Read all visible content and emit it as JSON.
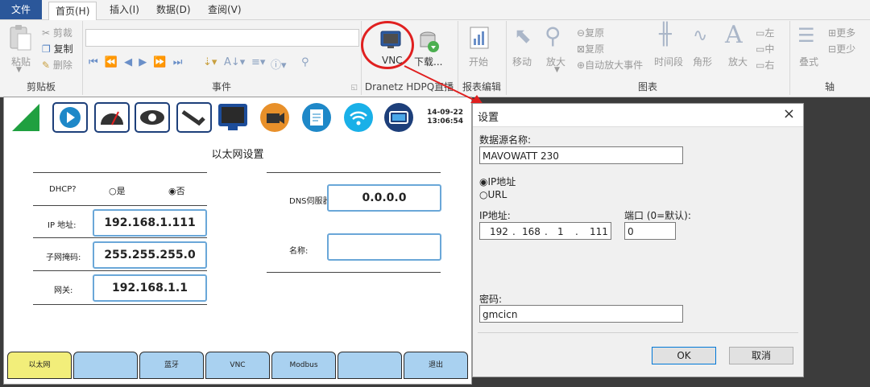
{
  "menubar": {
    "file": "文件",
    "tabs": [
      "首页(H)",
      "插入(I)",
      "数据(D)",
      "查阅(V)"
    ]
  },
  "clipboard": {
    "paste": "粘贴",
    "cut": "剪裁",
    "copy": "复制",
    "delete": "删除",
    "label": "剪贴板"
  },
  "events": {
    "label": "事件"
  },
  "dranetz": {
    "vnc": "VNC",
    "download": "下载...",
    "label": "Dranetz HDPQ直播"
  },
  "report": {
    "start": "开始",
    "label": "报表编辑"
  },
  "chart": {
    "move": "移动",
    "zoom": "放大",
    "restore1": "复原",
    "restore2": "复原",
    "auto_zoom": "自动放大事件",
    "time_period": "时间段",
    "angle": "角形",
    "zoom2": "放大",
    "left": "左",
    "middle": "中",
    "right": "右",
    "label": "图表"
  },
  "axis": {
    "stack": "叠式",
    "more": "更多",
    "less": "更少",
    "label": "轴"
  },
  "device": {
    "datetime_date": "14-09-22",
    "datetime_time": "13:06:54",
    "title": "以太网设置",
    "dhcp_label": "DHCP?",
    "dhcp_yes": "是",
    "dhcp_no": "否",
    "ip_label": "IP 地址:",
    "ip_value": "192.168.1.111",
    "subnet_label": "子网掩码:",
    "subnet_value": "255.255.255.0",
    "gateway_label": "网关:",
    "gateway_value": "192.168.1.1",
    "dns_label": "DNS伺服器:",
    "dns_value": "0.0.0.0",
    "name_label": "名称:",
    "name_value": "",
    "tabs": [
      "以太网",
      "",
      "蓝牙",
      "VNC",
      "Modbus",
      "",
      "退出"
    ]
  },
  "dialog": {
    "title": "设置",
    "close": "×",
    "source_label": "数据源名称:",
    "source_value": "MAVOWATT 230",
    "opt_ip": "IP地址",
    "opt_url": "URL",
    "ip_label": "IP地址:",
    "ip_parts": [
      "192",
      "168",
      "1",
      "111"
    ],
    "port_label": "端口 (0=默认):",
    "port_value": "0",
    "password_label": "密码:",
    "password_value": "gmcicn",
    "ok": "OK",
    "cancel": "取消"
  },
  "colors": {
    "ribbon_bg": "#f3f3f3",
    "file_tab": "#2b579a",
    "highlight_ring": "#e02020",
    "device_tab": "#a9d1f0",
    "device_tab_active": "#f2ee7a",
    "input_border": "#6aa7d8"
  }
}
